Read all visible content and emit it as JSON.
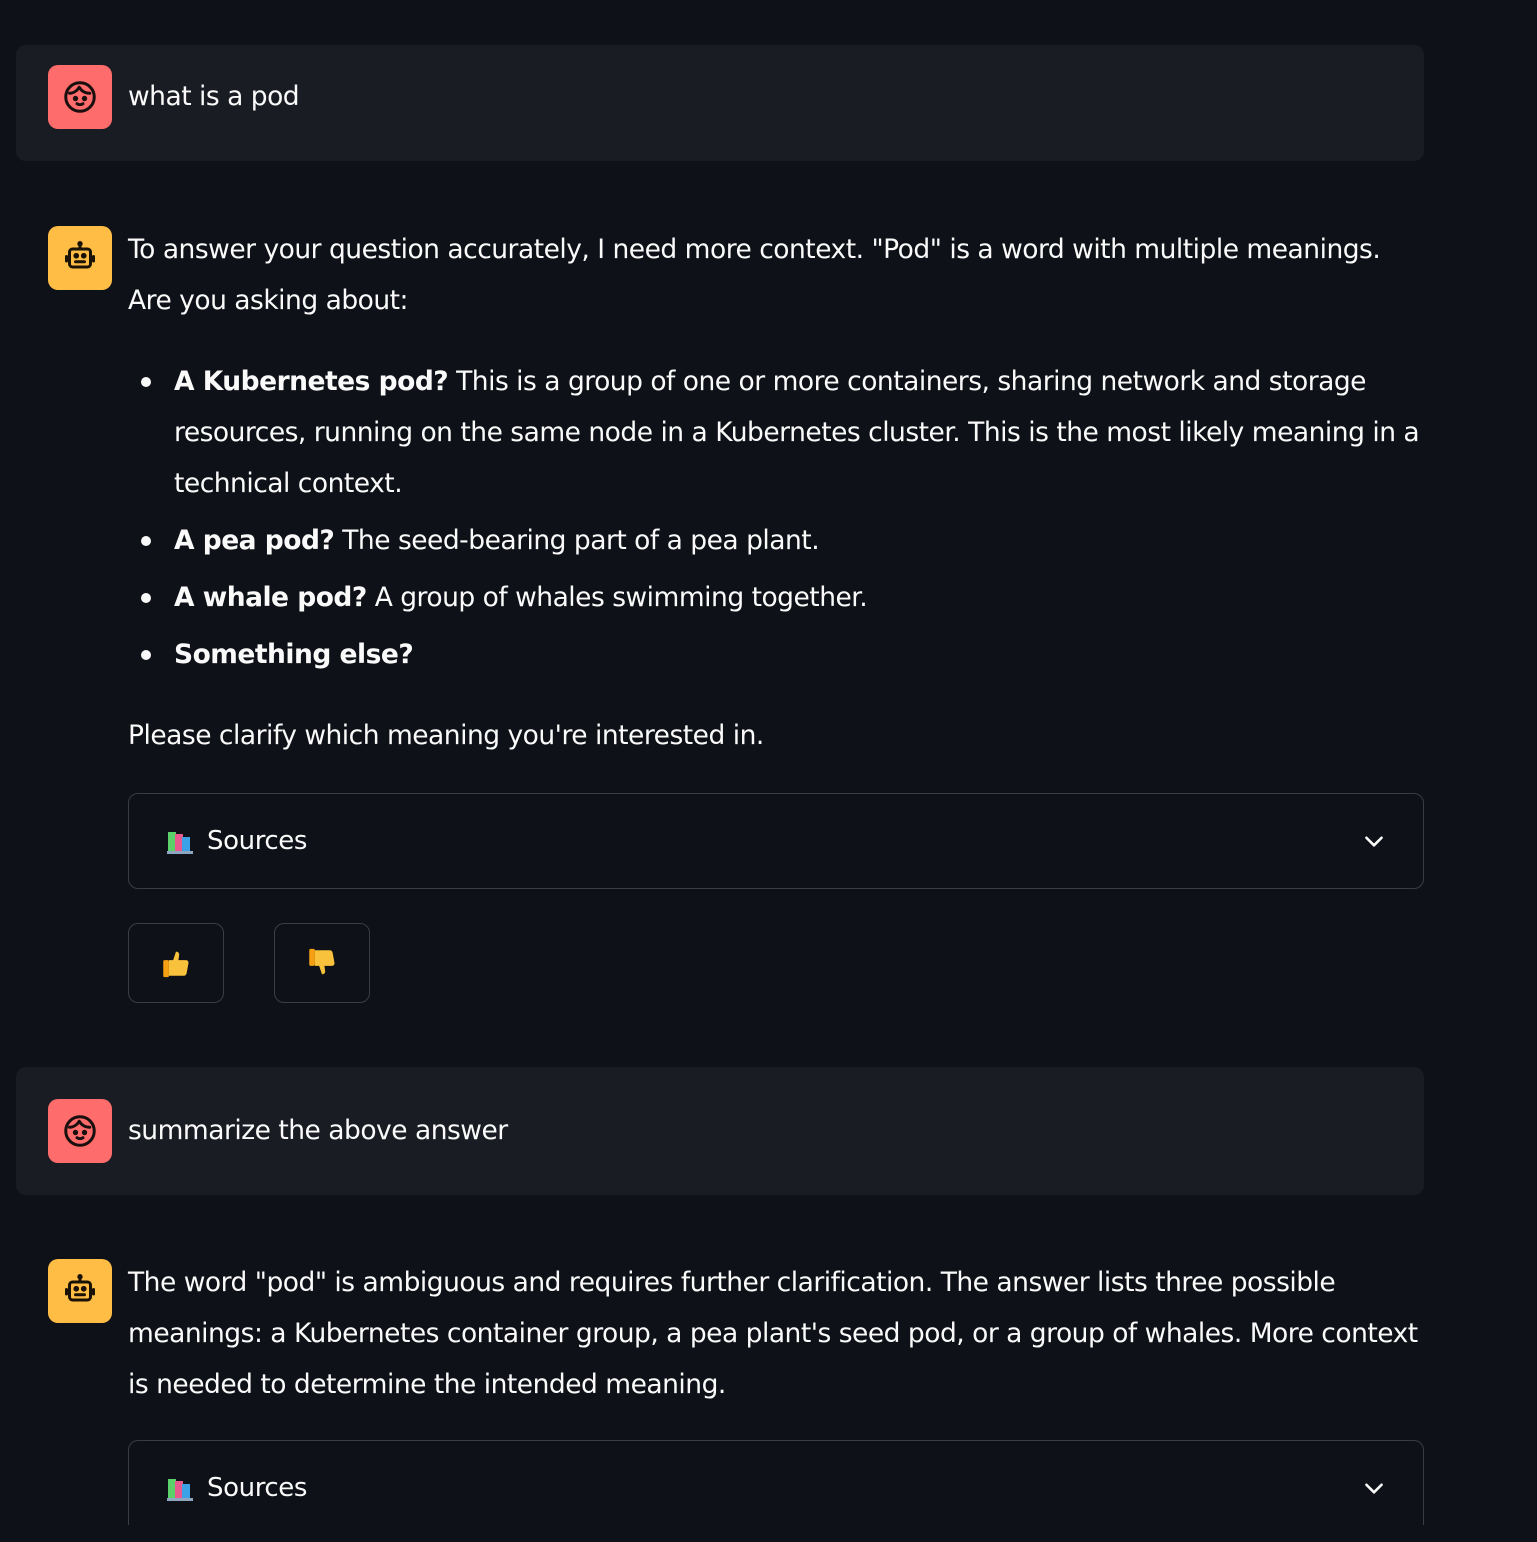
{
  "colors": {
    "background": "#0e1117",
    "user_bubble": "#1a1c24",
    "user_avatar": "#ff6c6c",
    "assistant_avatar": "#ffbd45",
    "border": "#3a3d46"
  },
  "messages": [
    {
      "role": "user",
      "avatar_icon": "face-icon",
      "text": "what is a pod"
    },
    {
      "role": "assistant",
      "avatar_icon": "robot-icon",
      "intro": "To answer your question accurately, I need more context. \"Pod\" is a word with multiple meanings. Are you asking about:",
      "options": [
        {
          "bold": "A Kubernetes pod?",
          "rest": " This is a group of one or more containers, sharing network and storage resources, running on the same node in a Kubernetes cluster. This is the most likely meaning in a technical context."
        },
        {
          "bold": "A pea pod?",
          "rest": " The seed-bearing part of a pea plant."
        },
        {
          "bold": "A whale pod?",
          "rest": " A group of whales swimming together."
        },
        {
          "bold": "Something else?",
          "rest": ""
        }
      ],
      "outro": "Please clarify which meaning you're interested in.",
      "sources_label": "Sources",
      "sources_icon": "books-icon",
      "feedback": {
        "up_icon": "thumbs-up-icon",
        "down_icon": "thumbs-down-icon"
      }
    },
    {
      "role": "user",
      "avatar_icon": "face-icon",
      "text": "summarize the above answer"
    },
    {
      "role": "assistant",
      "avatar_icon": "robot-icon",
      "text": "The word \"pod\" is ambiguous and requires further clarification. The answer lists three possible meanings: a Kubernetes container group, a pea plant's seed pod, or a group of whales. More context is needed to determine the intended meaning.",
      "sources_label": "Sources",
      "sources_icon": "books-icon"
    }
  ]
}
